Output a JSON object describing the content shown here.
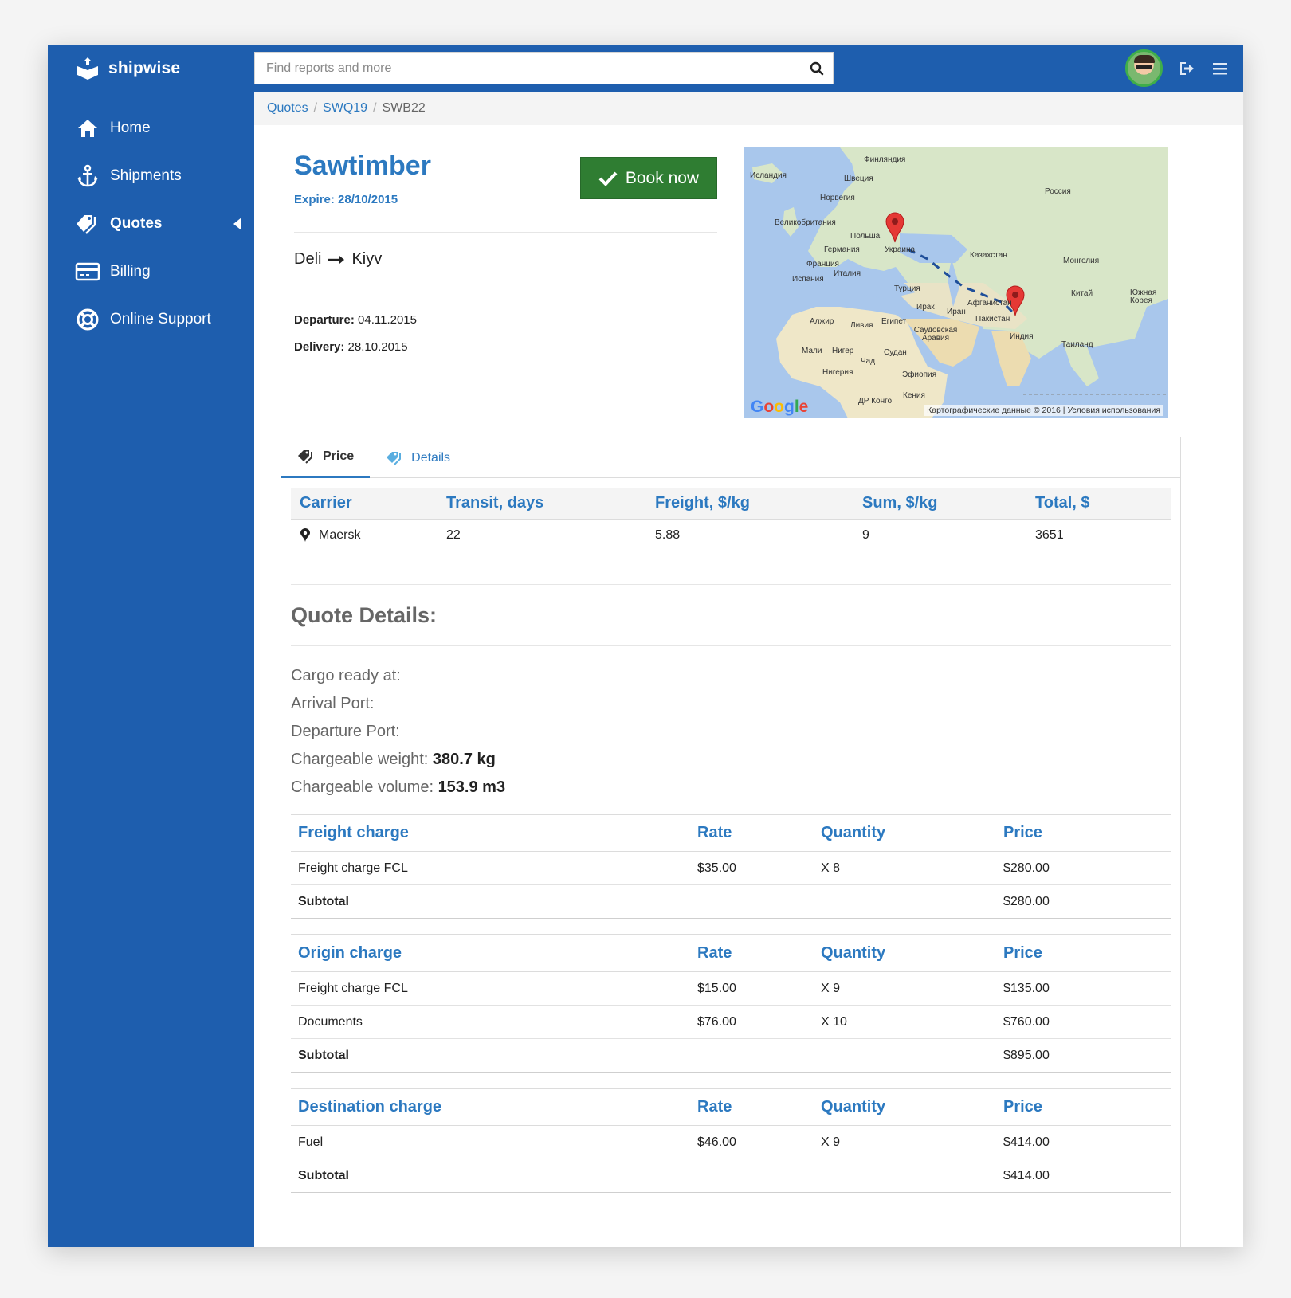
{
  "app": {
    "name": "shipwise"
  },
  "search": {
    "placeholder": "Find reports and more"
  },
  "sidebar": {
    "items": [
      {
        "label": "Home",
        "icon": "home-icon"
      },
      {
        "label": "Shipments",
        "icon": "anchor-icon"
      },
      {
        "label": "Quotes",
        "icon": "tag-icon",
        "active": true
      },
      {
        "label": "Billing",
        "icon": "credit-card-icon"
      },
      {
        "label": "Online Support",
        "icon": "lifebuoy-icon"
      }
    ]
  },
  "breadcrumb": {
    "items": [
      "Quotes",
      "SWQ19"
    ],
    "current": "SWB22"
  },
  "quote": {
    "title": "Sawtimber",
    "expire": "Expire: 28/10/2015",
    "book_label": "Book now",
    "route_from": "Deli",
    "route_to": "Kiyv",
    "departure_label": "Departure:",
    "departure_value": "04.11.2015",
    "delivery_label": "Delivery:",
    "delivery_value": "28.10.2015"
  },
  "map": {
    "labels": [
      "Финляндия",
      "Исландия",
      "Швеция",
      "Норвегия",
      "Россия",
      "Великобритания",
      "Польша",
      "Германия",
      "Украина",
      "Франция",
      "Казахстан",
      "Монголия",
      "Испания",
      "Италия",
      "Турция",
      "Китай",
      "Южная Корея",
      "Афганистан",
      "Ирак",
      "Иран",
      "Пакистан",
      "Алжир",
      "Ливия",
      "Египет",
      "Саудовская Аравия",
      "Индия",
      "Таиланд",
      "Мали",
      "Нигер",
      "Судан",
      "Чад",
      "Нигерия",
      "Эфиопия",
      "Кения",
      "ДР Конго"
    ],
    "google": "Google",
    "copyright": "Картографические данные © 2016",
    "terms": "Условия использования"
  },
  "tabs": [
    {
      "label": "Price",
      "active": true
    },
    {
      "label": "Details",
      "active": false
    }
  ],
  "price_table": {
    "headers": [
      "Carrier",
      "Transit, days",
      "Freight, $/kg",
      "Sum, $/kg",
      "Total, $"
    ],
    "rows": [
      {
        "carrier": "Maersk",
        "transit": "22",
        "freight": "5.88",
        "sum": "9",
        "total": "3651"
      }
    ]
  },
  "quote_details": {
    "title": "Quote Details:",
    "cargo_ready_label": "Cargo ready at:",
    "arrival_port_label": "Arrival Port:",
    "departure_port_label": "Departure Port:",
    "chargeable_weight_label": "Chargeable weight:",
    "chargeable_weight_value": "380.7 kg",
    "chargeable_volume_label": "Chargeable volume:",
    "chargeable_volume_value": "153.9 m3"
  },
  "charges": [
    {
      "title": "Freight charge",
      "rate": "Rate",
      "quantity": "Quantity",
      "price": "Price",
      "rows": [
        {
          "name": "Freight charge FCL",
          "rate": "$35.00",
          "qty": "X 8",
          "price": "$280.00"
        }
      ],
      "subtotal_label": "Subtotal",
      "subtotal": "$280.00"
    },
    {
      "title": "Origin charge",
      "rate": "Rate",
      "quantity": "Quantity",
      "price": "Price",
      "rows": [
        {
          "name": "Freight charge FCL",
          "rate": "$15.00",
          "qty": "X 9",
          "price": "$135.00"
        },
        {
          "name": "Documents",
          "rate": "$76.00",
          "qty": "X 10",
          "price": "$760.00"
        }
      ],
      "subtotal_label": "Subtotal",
      "subtotal": "$895.00"
    },
    {
      "title": "Destination charge",
      "rate": "Rate",
      "quantity": "Quantity",
      "price": "Price",
      "rows": [
        {
          "name": "Fuel",
          "rate": "$46.00",
          "qty": "X 9",
          "price": "$414.00"
        }
      ],
      "subtotal_label": "Subtotal",
      "subtotal": "$414.00"
    }
  ],
  "colors": {
    "brand": "#1e5eae",
    "accent": "#2c79c0",
    "book": "#2f7d32",
    "marker": "#e53935"
  }
}
